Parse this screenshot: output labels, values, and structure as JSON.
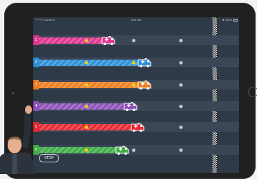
{
  "status_bar": {
    "left": "••••○ Carrier ✆",
    "time": "9:41 AM",
    "right": "✱ 100%"
  },
  "finish_line": {
    "style": "checkered",
    "colors": [
      "#111111",
      "#ffffff"
    ]
  },
  "lanes": [
    {
      "number": "1",
      "color": "#e0348f",
      "progress": 0.37,
      "checkpoints_reached": 1
    },
    {
      "number": "2",
      "color": "#2b8fd6",
      "progress": 0.58,
      "checkpoints_reached": 2
    },
    {
      "number": "3",
      "color": "#f07d1c",
      "progress": 0.58,
      "checkpoints_reached": 2
    },
    {
      "number": "4",
      "color": "#8d4fb8",
      "progress": 0.5,
      "checkpoints_reached": 1
    },
    {
      "number": "5",
      "color": "#e8262f",
      "progress": 0.54,
      "checkpoints_reached": 2
    },
    {
      "number": "6",
      "color": "#3fad45",
      "progress": 0.45,
      "checkpoints_reached": 1
    }
  ],
  "controls": {
    "stop_label": "STOP"
  },
  "colors": {
    "screen_bg": "#2f3a48",
    "lane_bg": "#3b4757",
    "checkpoint_reached": "#f3e21c",
    "checkpoint_pending": "#c7cbd2"
  }
}
